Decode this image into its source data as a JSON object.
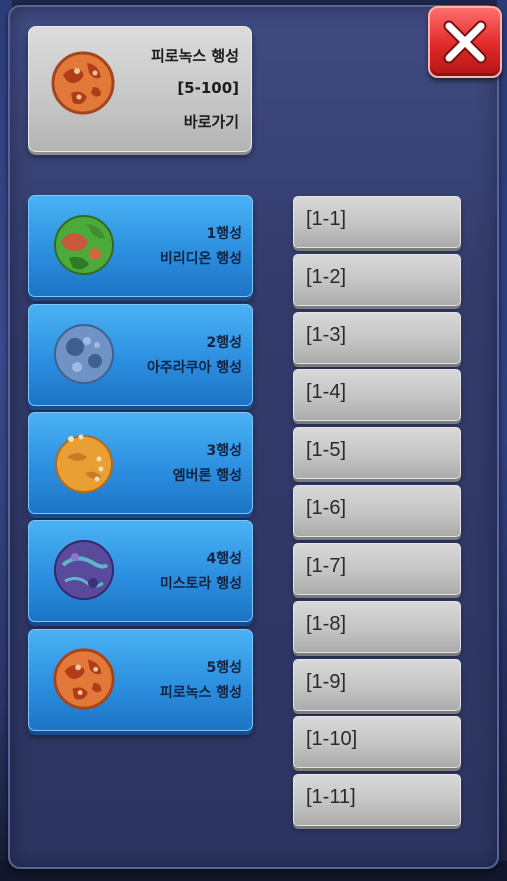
{
  "current_planet": {
    "name": "피로녹스 행성",
    "range": "[5-100]",
    "shortcut_label": "바로가기"
  },
  "planets": [
    {
      "number": "1행성",
      "name": "비리디온 행성",
      "icon": "green-planet-icon"
    },
    {
      "number": "2행성",
      "name": "아주라쿠아 행성",
      "icon": "blue-planet-icon"
    },
    {
      "number": "3행성",
      "name": "엠버론 행성",
      "icon": "orange-planet-icon"
    },
    {
      "number": "4행성",
      "name": "미스토라 행성",
      "icon": "purple-planet-icon"
    },
    {
      "number": "5행성",
      "name": "피로녹스 행성",
      "icon": "lava-planet-icon"
    }
  ],
  "stages": [
    "[1-1]",
    "[1-2]",
    "[1-3]",
    "[1-4]",
    "[1-5]",
    "[1-6]",
    "[1-7]",
    "[1-8]",
    "[1-9]",
    "[1-10]",
    "[1-11]"
  ],
  "close_icon": "close-icon",
  "colors": {
    "panel": "#323b6a",
    "planet_button": "#2c8fe0",
    "stage_button": "#c4c4c4",
    "close_button": "#e02828"
  }
}
